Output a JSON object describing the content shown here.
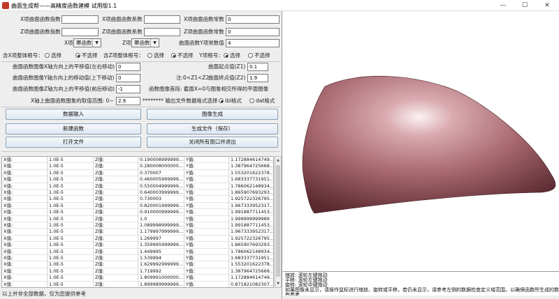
{
  "window": {
    "title": "曲面生成帮——高精度函数建模   试用版1.1",
    "min": "—",
    "max": "☐",
    "close": "✕"
  },
  "coeffs": {
    "x_exp_label": "X项曲面函数指数",
    "x_exp_value": "",
    "x_coef_label": "X项曲面函数系数",
    "x_coef_value": "",
    "x_const_label": "X项曲面函数常数",
    "x_const_value": "0",
    "z_exp_label": "Z项曲面函数指数",
    "z_exp_value": "",
    "z_coef_label": "Z项曲面函数系数",
    "z_coef_value": "",
    "z_const_label": "Z项曲面函数常数",
    "z_const_value": "0"
  },
  "types": {
    "x_label": "X项",
    "x_value": "幂函数",
    "z_label": "Z项",
    "z_value": "幂函数",
    "y_const_label": "曲面函数Y项常数值",
    "y_const_value": "4"
  },
  "radios": {
    "x_whole_label": "含X项整体根号：",
    "z_whole_label": "含Z项整体根号：",
    "y_root_label": "Y项根号：",
    "select": "选择",
    "not_select": "不选择"
  },
  "moves": {
    "x_shift_label": "曲面函数图像X轴方向上的平移值(左右移动)",
    "x_shift_value": "0",
    "y_shift_label": "曲面函数图像Y轴方向上的移动值(上下移动)",
    "y_shift_value": "0",
    "z_shift_label": "曲面函数图像Z轴方向上的平移值(前后移动)",
    "z_shift_value": "-1",
    "z1_label": "曲面起点值(Z1)",
    "z1_value": "0.1",
    "note": "注:0<Z1<Z2",
    "z2_label": "曲面终点值(Z2)",
    "z2_value": "1.9",
    "head_note": "函数图像首段: 截面X=0与图象相交所得的平面图像",
    "range_label": "X轴上曲面函数图象的取值范围: 0~",
    "range_value": "2.9",
    "format_label": "********  输出文件数据格式选择",
    "fmt_ibl": "ibl格式",
    "fmt_dat": "dat格式"
  },
  "buttons": {
    "data_input": "数据输入",
    "image_gen": "图像生成",
    "new_func": "新建函数",
    "gen_file": "生成文件（保存）",
    "open_file": "打开文件",
    "close_all": "关闭所有窗口并退出"
  },
  "table": {
    "rows": [
      [
        "X值:",
        "1.0E-5",
        "Z值:",
        "0.190008999999...",
        "Y值:",
        "1.172884614749..."
      ],
      [
        "X值:",
        "1.0E-5",
        "Z值:",
        "0.280008000000...",
        "Y值:",
        "1.387964725668..."
      ],
      [
        "X值:",
        "1.0E-5",
        "Z值:",
        "0.370007",
        "Y值:",
        "1.553201622378..."
      ],
      [
        "X值:",
        "1.0E-5",
        "Z值:",
        "0.460005999999...",
        "Y值:",
        "1.683337731951..."
      ],
      [
        "X值:",
        "1.0E-5",
        "Z值:",
        "0.550004999999...",
        "Y值:",
        "1.786062148934..."
      ],
      [
        "X值:",
        "1.0E-5",
        "Z值:",
        "0.640003999999...",
        "Y值:",
        "1.865907693293..."
      ],
      [
        "X值:",
        "1.0E-5",
        "Z值:",
        "0.730003",
        "Y值:",
        "1.925722326795..."
      ],
      [
        "X值:",
        "1.0E-5",
        "Z值:",
        "0.820001999999...",
        "Y值:",
        "1.967333952317..."
      ],
      [
        "X值:",
        "1.0E-5",
        "Z值:",
        "0.910000999999...",
        "Y值:",
        "1.991887711453..."
      ],
      [
        "X值:",
        "1.0E-5",
        "Z值:",
        "1.0",
        "Y值:",
        "1.999999999989"
      ],
      [
        "X值:",
        "1.0E-5",
        "Z值:",
        "1.089998999999...",
        "Y值:",
        "1.991887711453..."
      ],
      [
        "X值:",
        "1.0E-5",
        "Z值:",
        "1.179997999999...",
        "Y值:",
        "1.967333952317..."
      ],
      [
        "X值:",
        "1.0E-5",
        "Z值:",
        "1.269997",
        "Y值:",
        "1.925722326795..."
      ],
      [
        "X值:",
        "1.0E-5",
        "Z值:",
        "1.359995999999...",
        "Y值:",
        "1.865907693293..."
      ],
      [
        "X值:",
        "1.0E-5",
        "Z值:",
        "1.449995",
        "Y值:",
        "1.786062148934..."
      ],
      [
        "X值:",
        "1.0E-5",
        "Z值:",
        "1.539994",
        "Y值:",
        "1.683337731951..."
      ],
      [
        "X值:",
        "1.0E-5",
        "Z值:",
        "1.629992999999...",
        "Y值:",
        "1.553201622378..."
      ],
      [
        "X值:",
        "1.0E-5",
        "Z值:",
        "1.719992",
        "Y值:",
        "1.387964725668..."
      ],
      [
        "X值:",
        "1.0E-5",
        "Z值:",
        "1.809991000000...",
        "Y值:",
        "1.172884614749..."
      ],
      [
        "X值:",
        "1.0E-5",
        "Z值:",
        "1.899989999999...",
        "Y值:",
        "0.871821082307..."
      ]
    ]
  },
  "status": "以上并非全部数据，仅为您提供参考",
  "info": {
    "lines": [
      "缩放: 滚轮左键拖动",
      "平移: 滚轮左键拖动",
      "旋转: 滚轮中键拖动",
      "如果图像未显示，请操作鼠标进行缩放、旋转或平移，若仍未显示，请参考左侧的数据检查定义域范围，以确保函数所生成的数",
      "有参考"
    ]
  },
  "colors": {
    "surface_light": "#f4e6e8",
    "surface_mid": "#a8686f",
    "surface_dark": "#5a2a30"
  }
}
